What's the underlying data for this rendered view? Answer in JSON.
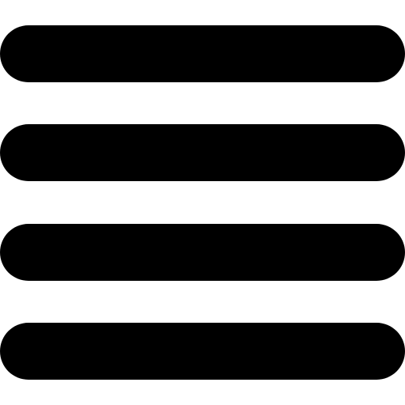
{
  "menu": {
    "icon": "hamburger-menu-icon",
    "bar_count": 4,
    "color": "#000000",
    "background": "#ffffff"
  }
}
